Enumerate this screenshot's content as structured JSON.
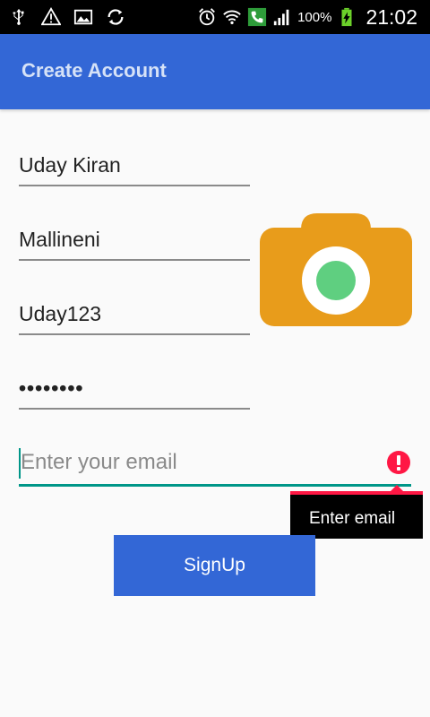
{
  "status_bar": {
    "icons_left": [
      "usb-icon",
      "warning-icon",
      "image-icon",
      "sync-icon"
    ],
    "icons_right": [
      "alarm-icon",
      "wifi-icon",
      "call-icon",
      "signal-icon"
    ],
    "battery_percent": "100%",
    "time": "21:02"
  },
  "app_bar": {
    "title": "Create Account",
    "color": "#3367d6"
  },
  "form": {
    "first_name": "Uday Kiran",
    "last_name": "Mallineni",
    "username": "Uday123",
    "password_masked": "••••••••",
    "email_placeholder": "Enter your email",
    "email_error": "Enter email",
    "signup_label": "SignUp"
  },
  "colors": {
    "accent": "#009688",
    "error": "#ff1744",
    "camera": "#e89c1b",
    "camera_lens": "#5fcf80"
  }
}
